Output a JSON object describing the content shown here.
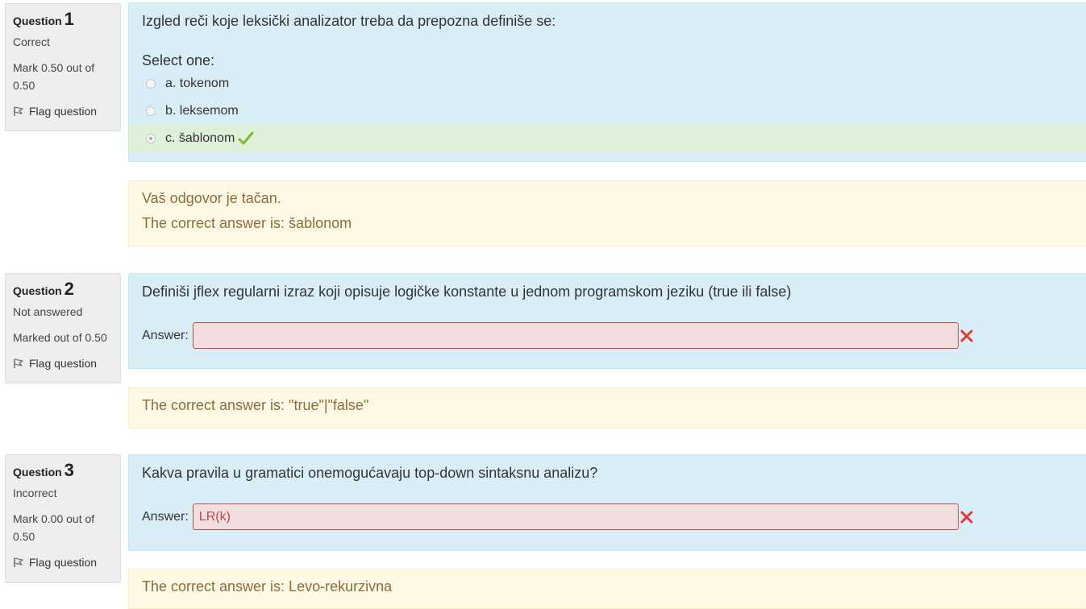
{
  "questions": [
    {
      "label": "Question",
      "number": "1",
      "state": "Correct",
      "grade": "Mark 0.50 out of 0.50",
      "flag": "Flag question",
      "text": "Izgled reči koje leksički analizator treba da prepozna definiše se:",
      "prompt": "Select one:",
      "options": [
        {
          "label": "a. tokenom"
        },
        {
          "label": "b. leksemom"
        },
        {
          "label": "c. šablonom"
        }
      ],
      "feedback": [
        "Vaš odgovor je tačan.",
        "The correct answer is: šablonom"
      ]
    },
    {
      "label": "Question",
      "number": "2",
      "state": "Not answered",
      "grade": "Marked out of 0.50",
      "flag": "Flag question",
      "text": "Definiši jflex regularni izraz koji opisuje logičke konstante u jednom programskom jeziku (true ili false)",
      "answer_label": "Answer:",
      "answer_value": "",
      "feedback": [
        "The correct answer is: \"true\"|\"false\""
      ]
    },
    {
      "label": "Question",
      "number": "3",
      "state": "Incorrect",
      "grade": "Mark 0.00 out of 0.50",
      "flag": "Flag question",
      "text": "Kakva pravila u gramatici onemogućavaju top-down sintaksnu analizu?",
      "answer_label": "Answer:",
      "answer_value": "LR(k)",
      "feedback": [
        "The correct answer is: Levo-rekurzivna"
      ]
    }
  ],
  "colors": {
    "formulation_bg": "#d9edf7",
    "outcome_bg": "#fcf8e3",
    "correct_bg": "#dff0d8",
    "incorrect_border": "#b94a48",
    "check": "#7cbb2d",
    "cross": "#e53935"
  },
  "icons": {
    "flag": "flag-icon",
    "correct": "checkmark-icon",
    "incorrect": "cross-icon"
  }
}
